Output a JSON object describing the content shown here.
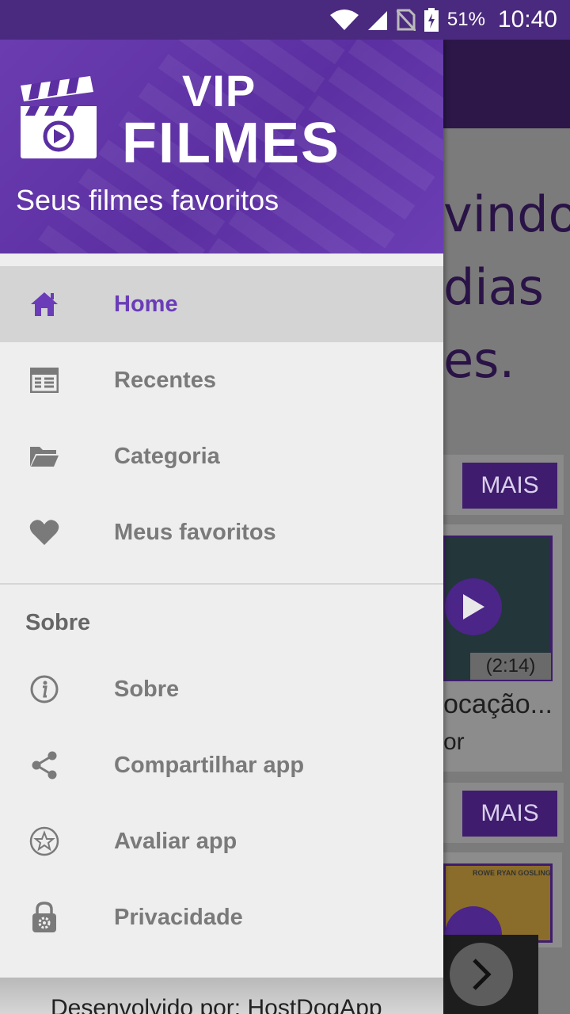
{
  "status_bar": {
    "battery_percent": "51%",
    "time": "10:40",
    "icons": [
      "wifi-icon",
      "signal-icon",
      "no-sim-icon",
      "battery-charging-icon"
    ]
  },
  "drawer": {
    "logo_line1": "VIP",
    "logo_line2": "FILMES",
    "tagline": "Seus filmes favoritos",
    "items": [
      {
        "label": "Home",
        "icon": "home-icon",
        "active": true
      },
      {
        "label": "Recentes",
        "icon": "calendar-icon"
      },
      {
        "label": "Categoria",
        "icon": "folder-icon"
      },
      {
        "label": "Meus favoritos",
        "icon": "heart-icon"
      }
    ],
    "section_title": "Sobre",
    "about_items": [
      {
        "label": "Sobre",
        "icon": "info-icon"
      },
      {
        "label": "Compartilhar app",
        "icon": "share-icon"
      },
      {
        "label": "Avaliar app",
        "icon": "star-icon"
      },
      {
        "label": "Privacidade",
        "icon": "lock-icon"
      }
    ],
    "footer": "Desenvolvido por: HostDogApp"
  },
  "background": {
    "welcome_lines": [
      "vindo!",
      "dias",
      "es."
    ],
    "more_label": "MAIS",
    "video_duration": "(2:14)",
    "video_title": "ocação...",
    "video_subtitle": "or",
    "poster_names": "ROWE   RYAN GOSLING"
  },
  "colors": {
    "accent": "#6a3cb8",
    "header": "#5b2fa1",
    "status_bar": "#4a2a7e"
  }
}
